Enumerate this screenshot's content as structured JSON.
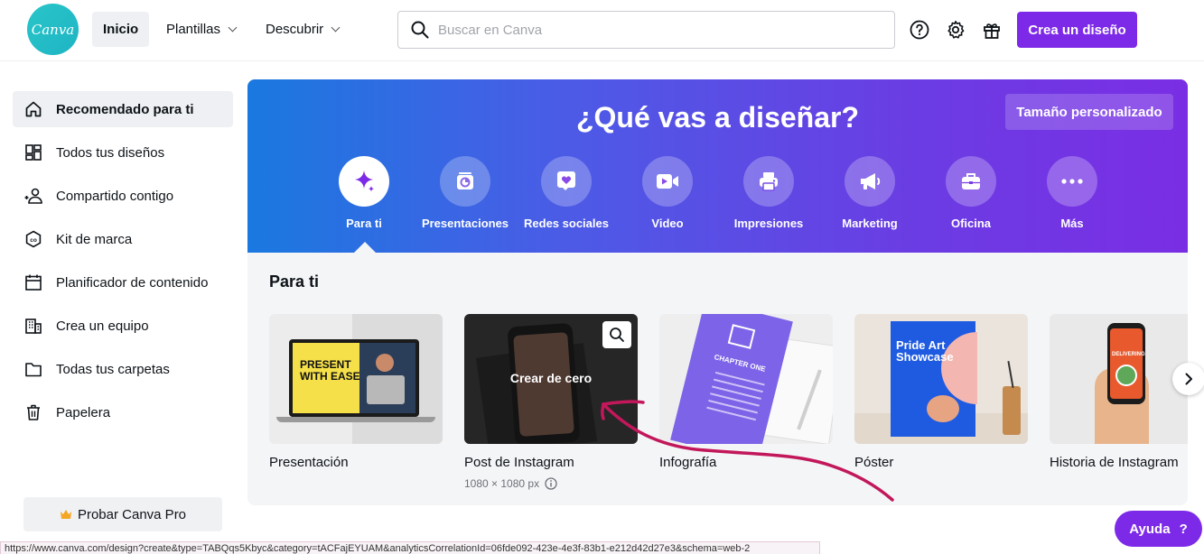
{
  "header": {
    "logo_text": "Canva",
    "nav": [
      {
        "label": "Inicio",
        "active": true
      },
      {
        "label": "Plantillas",
        "has_dropdown": true
      },
      {
        "label": "Descubrir",
        "has_dropdown": true
      }
    ],
    "search_placeholder": "Buscar en Canva",
    "icons": [
      "help-icon",
      "settings-icon",
      "gift-icon"
    ],
    "create_label": "Crea un diseño"
  },
  "sidebar": {
    "items": [
      {
        "label": "Recomendado para ti",
        "icon": "home-icon",
        "active": true
      },
      {
        "label": "Todos tus diseños",
        "icon": "grid-icon"
      },
      {
        "label": "Compartido contigo",
        "icon": "shared-users-icon"
      },
      {
        "label": "Kit de marca",
        "icon": "brand-kit-icon"
      },
      {
        "label": "Planificador de contenido",
        "icon": "calendar-icon"
      },
      {
        "label": "Crea un equipo",
        "icon": "building-icon"
      },
      {
        "label": "Todas tus carpetas",
        "icon": "folder-icon"
      },
      {
        "label": "Papelera",
        "icon": "trash-icon"
      }
    ],
    "pro_label": "Probar Canva Pro"
  },
  "hero": {
    "title": "¿Qué vas a diseñar?",
    "custom_size_label": "Tamaño personalizado",
    "categories": [
      {
        "label": "Para ti",
        "icon": "sparkle-icon",
        "active": true
      },
      {
        "label": "Presentaciones",
        "icon": "presentation-icon"
      },
      {
        "label": "Redes sociales",
        "icon": "heart-icon"
      },
      {
        "label": "Video",
        "icon": "video-icon"
      },
      {
        "label": "Impresiones",
        "icon": "printer-icon"
      },
      {
        "label": "Marketing",
        "icon": "megaphone-icon"
      },
      {
        "label": "Oficina",
        "icon": "briefcase-icon"
      },
      {
        "label": "Más",
        "icon": "more-icon"
      }
    ]
  },
  "section": {
    "title": "Para ti",
    "cards": [
      {
        "title": "Presentación",
        "thumb_text": [
          "PRESENT",
          "WITH EASE"
        ]
      },
      {
        "title": "Post de Instagram",
        "subtitle": "1080 × 1080 px",
        "overlay": "Crear de cero",
        "hovered": true
      },
      {
        "title": "Infografía",
        "thumb_text": [
          "CHAPTER ONE"
        ]
      },
      {
        "title": "Póster",
        "thumb_text": [
          "Pride Art",
          "Showcase"
        ]
      },
      {
        "title": "Historia de Instagram",
        "thumb_text": [
          "DELIVERING"
        ]
      }
    ]
  },
  "help_label": "Ayuda",
  "help_mark": "?",
  "status_url": "https://www.canva.com/design?create&type=TABQqs5Kbyc&category=tACFajEYUAM&analyticsCorrelationId=06fde092-423e-4e3f-83b1-e212d42d27e3&schema=web-2",
  "colors": {
    "brand_purple": "#7d2ae8",
    "annotation_red": "#c2185b",
    "logo_teal": "#20c4cb"
  }
}
